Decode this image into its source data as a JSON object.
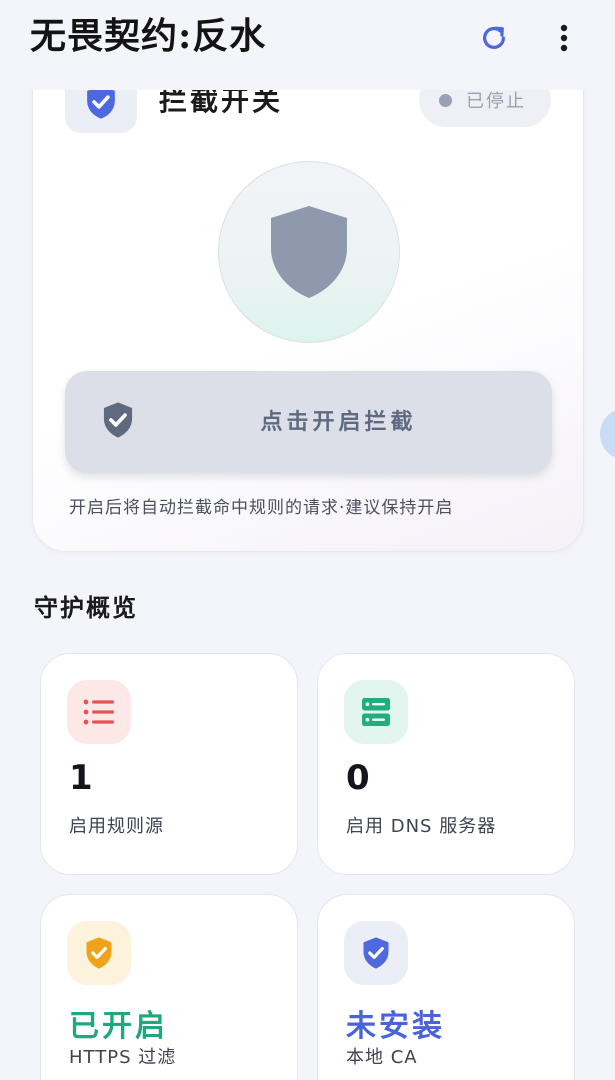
{
  "app": {
    "title": "无畏契约:反水"
  },
  "toolbar": {
    "refresh_icon": "refresh-icon",
    "more_icon": "more-vertical-icon"
  },
  "intercept": {
    "title": "拦截开关",
    "status": "已停止",
    "button_label": "点击开启拦截",
    "hint": "开启后将自动拦截命中规则的请求·建议保持开启",
    "state": "off"
  },
  "overview": {
    "title": "守护概览",
    "cards": [
      {
        "value": "1",
        "label": "启用规则源",
        "icon": "list-icon",
        "icon_color": "#e55353",
        "icon_bg": "#fde8e8"
      },
      {
        "value": "0",
        "label": "启用 DNS 服务器",
        "icon": "server-icon",
        "icon_color": "#1fae7c",
        "icon_bg": "#e2f6ef"
      },
      {
        "value": "已开启",
        "label": "HTTPS 过滤",
        "icon": "shield-check-icon",
        "icon_color": "#f0a21a",
        "icon_bg": "#fdf3dc",
        "value_color": "#1ea978"
      },
      {
        "value": "未安装",
        "label": "本地 CA",
        "icon": "shield-check-icon",
        "icon_color": "#4e68e0",
        "icon_bg": "#eceef7",
        "value_color": "#4b63d8"
      }
    ]
  },
  "colors": {
    "accent": "#4e68e0",
    "background": "#f4f5fb",
    "inactive": "#8f99ad"
  }
}
